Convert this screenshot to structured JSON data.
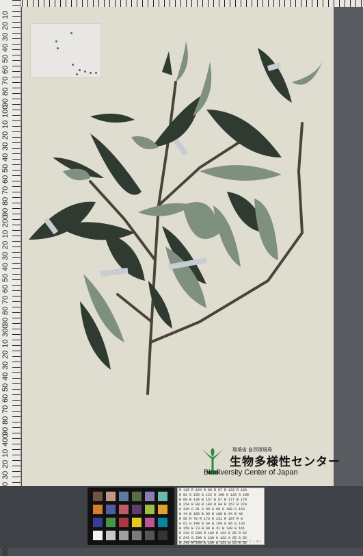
{
  "ruler": {
    "labels": [
      "10",
      "20",
      "30",
      "40",
      "50",
      "60",
      "70",
      "80",
      "90",
      "100",
      "10",
      "20",
      "30",
      "40",
      "50",
      "60",
      "70",
      "80",
      "90",
      "200",
      "10",
      "20",
      "30",
      "40",
      "50",
      "60",
      "70",
      "80",
      "90",
      "300",
      "10",
      "20",
      "30",
      "40",
      "50",
      "60",
      "70",
      "80",
      "90",
      "400",
      "10",
      "20",
      "30",
      "40",
      "50",
      "60",
      "70",
      "80",
      "90",
      "500"
    ]
  },
  "logo": {
    "subtitle": "環境省 自然環境局",
    "name_jp": "生物多様性センター",
    "name_en": "Biodiversity Center of Japan"
  },
  "color_table": {
    "rows": [
      "R 115  R 194  R 98   R 87   R 133  R 103",
      "G 82   G 150  G 122  G 108  G 128  G 189",
      "B 68   B 130  B 157  B 67   B 177  B 170",
      "R 214  R 80   R 193  R 94   R 157  R 224",
      "G 126  G 91   G 90   G 60   G 188  G 163",
      "B 44   B 166  B 99   B 108  B 64   B 46",
      "R 56   R 70   R 175  R 231  R 187  R 8",
      "G 61   G 148  G 54   G 199  G 86   G 133",
      "B 150  B 73   B 60   B 31   B 149  B 161",
      "R 243  R 200  R 160  R 122  R 85   R 52",
      "G 243  G 200  G 160  G 122  G 85   G 52",
      "B 242  B 200  B 160  B 121  B 85   B 52"
    ],
    "footnote": "by GretagMacbeth color checker (Illuminant C / 2°)"
  },
  "colors": {
    "sheet": "#dfdcd0",
    "leaf_dark": "#2f3a30",
    "leaf_light": "#7f8f80",
    "stem": "#4a4438"
  },
  "swatch_colors": [
    "#735244",
    "#c29682",
    "#627a9d",
    "#576c43",
    "#8580b1",
    "#67bdaa",
    "#d67e2c",
    "#505ba6",
    "#c15a63",
    "#5e3c6c",
    "#9dbc40",
    "#e0a32e",
    "#383d96",
    "#469449",
    "#af363c",
    "#e7c71f",
    "#bb5695",
    "#0885a1",
    "#f3f3f2",
    "#c8c8c8",
    "#a0a0a0",
    "#7a7a79",
    "#555555",
    "#343434"
  ]
}
